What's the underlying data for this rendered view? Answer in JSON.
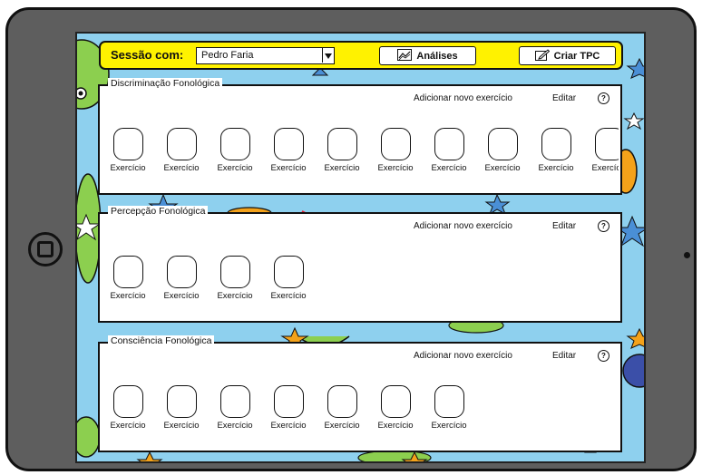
{
  "topbar": {
    "session_label": "Sessão com:",
    "patient_select_value": "Pedro Faria",
    "analyses_button": "Análises",
    "create_homework_button": "Criar TPC"
  },
  "sections": [
    {
      "title": "Discriminação Fonológica",
      "add_label": "Adicionar novo exercício",
      "edit_label": "Editar",
      "help": "?",
      "exercises": [
        "Exercício",
        "Exercício",
        "Exercício",
        "Exercício",
        "Exercício",
        "Exercício",
        "Exercício",
        "Exercício",
        "Exercício",
        "Exercício"
      ]
    },
    {
      "title": "Percepção Fonológica",
      "add_label": "Adicionar novo exercício",
      "edit_label": "Editar",
      "help": "?",
      "exercises": [
        "Exercício",
        "Exercício",
        "Exercício",
        "Exercício"
      ]
    },
    {
      "title": "Consciência Fonológica",
      "add_label": "Adicionar novo exercício",
      "edit_label": "Editar",
      "help": "?",
      "exercises": [
        "Exercício",
        "Exercício",
        "Exercício",
        "Exercício",
        "Exercício",
        "Exercício",
        "Exercício"
      ]
    }
  ],
  "icons": {
    "select_arrow": "chevron-down-icon",
    "analyses": "chart-icon",
    "create": "edit-icon",
    "help": "help-icon",
    "home": "home-button-icon"
  },
  "colors": {
    "background": "#8ed0ee",
    "topbar": "#fff200",
    "device": "#5e5e5e"
  }
}
